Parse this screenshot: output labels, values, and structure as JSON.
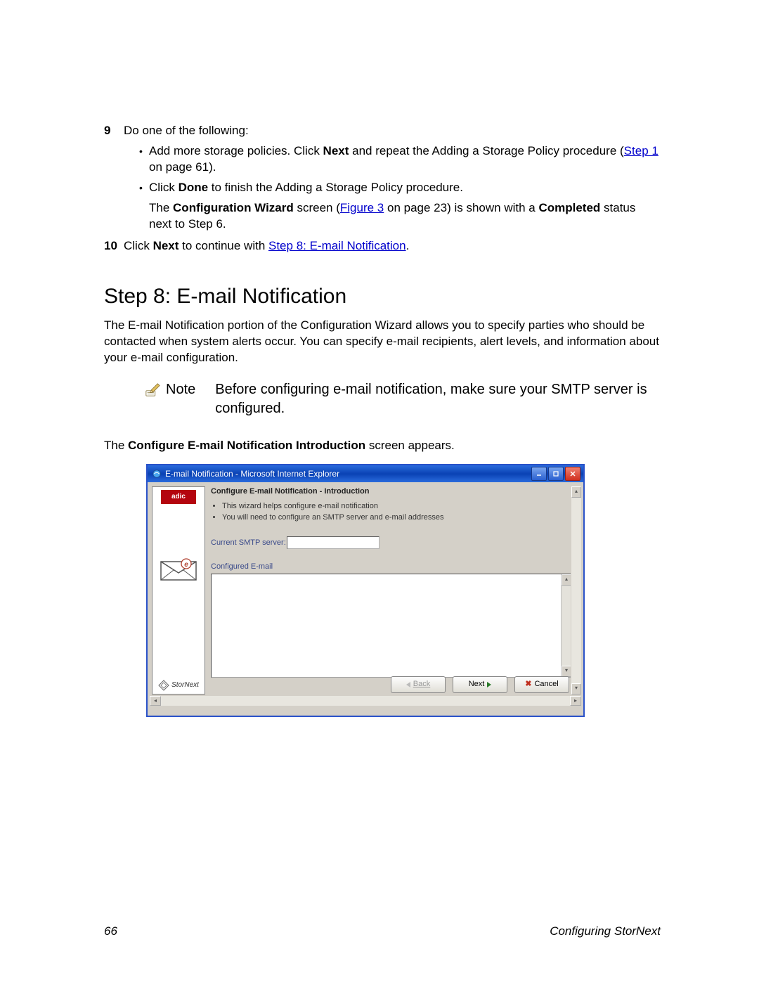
{
  "steps": {
    "s9": {
      "num": "9",
      "lead": "Do one of the following:",
      "b1_pre": "Add more storage policies. Click ",
      "b1_bold": "Next",
      "b1_mid": " and repeat the Adding a Storage Policy procedure (",
      "b1_link": "Step 1",
      "b1_post": " on page 61).",
      "b2_pre": "Click ",
      "b2_bold": "Done",
      "b2_post": " to finish the Adding a Storage Policy procedure.",
      "b2_follow_pre": "The ",
      "b2_follow_bold": "Configuration Wizard",
      "b2_follow_mid": " screen (",
      "b2_follow_link": "Figure 3",
      "b2_follow_mid2": " on page 23) is shown with a ",
      "b2_follow_bold2": "Completed",
      "b2_follow_post": " status next to Step 6."
    },
    "s10": {
      "num": "10",
      "pre": "Click ",
      "bold": "Next",
      "mid": " to continue with ",
      "link": "Step 8: E-mail Notification",
      "post": "."
    }
  },
  "heading": "Step 8: E-mail Notification",
  "intro": "The E-mail Notification portion of the Configuration Wizard allows you to specify parties who should be contacted when system alerts occur. You can specify e-mail recipients, alert levels, and information about your e-mail configuration.",
  "note": {
    "label": "Note",
    "text": "Before configuring e-mail notification, make sure your SMTP server is configured."
  },
  "appears_pre": "The ",
  "appears_bold": "Configure E-mail Notification Introduction",
  "appears_post": " screen appears.",
  "window": {
    "title": "E-mail Notification - Microsoft Internet Explorer",
    "logo": "adic",
    "brand": "StorNext",
    "content_title": "Configure E-mail Notification - Introduction",
    "bullet1": "This wizard helps configure e-mail notification",
    "bullet2": "You will need to configure an SMTP server and e-mail addresses",
    "smtp_label": "Current SMTP server:",
    "list_label": "Configured E-mail",
    "back": "Back",
    "next": "Next",
    "cancel": "Cancel"
  },
  "footer": {
    "pagenum": "66",
    "section": "Configuring StorNext"
  }
}
